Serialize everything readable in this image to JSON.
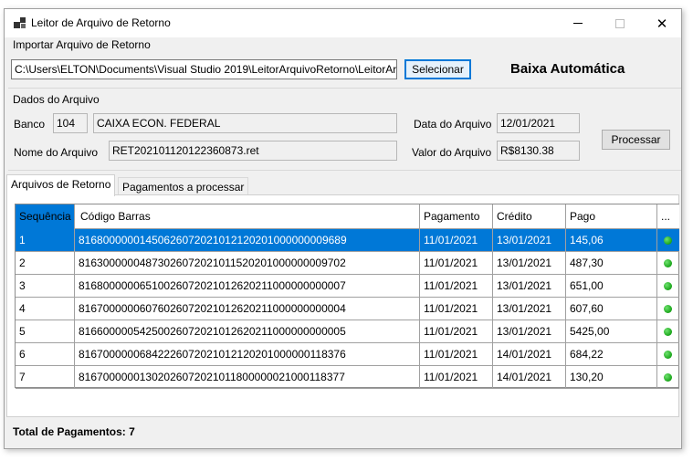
{
  "window": {
    "title": "Leitor de Arquivo de Retorno",
    "close_glyph": "✕"
  },
  "import_group": {
    "label": "Importar Arquivo de Retorno",
    "file_path": "C:\\Users\\ELTON\\Documents\\Visual Studio 2019\\LeitorArquivoRetorno\\LeitorArq",
    "select_button": "Selecionar",
    "heading": "Baixa Automática"
  },
  "file_data": {
    "label": "Dados do Arquivo",
    "bank_label": "Banco",
    "bank_code": "104",
    "bank_name": "CAIXA ECON. FEDERAL",
    "file_name_label": "Nome do Arquivo",
    "file_name": "RET202101120122360873.ret",
    "file_date_label": "Data do Arquivo",
    "file_date": "12/01/2021",
    "file_value_label": "Valor do Arquivo",
    "file_value": "R$8130.38",
    "process_button": "Processar"
  },
  "tabs": [
    {
      "label": "Arquivos de Retorno",
      "active": true
    },
    {
      "label": "Pagamentos a processar",
      "active": false
    }
  ],
  "grid": {
    "columns": [
      "Sequência",
      "Código Barras",
      "Pagamento",
      "Crédito",
      "Pago",
      "..."
    ],
    "rows": [
      {
        "seq": "1",
        "code": "81680000001450626072021012120201000000009689",
        "payment": "11/01/2021",
        "credit": "13/01/2021",
        "paid": "145,06",
        "status": "ok",
        "selected": true
      },
      {
        "seq": "2",
        "code": "81630000004873026072021011520201000000009702",
        "payment": "11/01/2021",
        "credit": "13/01/2021",
        "paid": "487,30",
        "status": "ok",
        "selected": false
      },
      {
        "seq": "3",
        "code": "81680000006510026072021012620211000000000007",
        "payment": "11/01/2021",
        "credit": "13/01/2021",
        "paid": "651,00",
        "status": "ok",
        "selected": false
      },
      {
        "seq": "4",
        "code": "81670000006076026072021012620211000000000004",
        "payment": "11/01/2021",
        "credit": "13/01/2021",
        "paid": "607,60",
        "status": "ok",
        "selected": false
      },
      {
        "seq": "5",
        "code": "81660000054250026072021012620211000000000005",
        "payment": "11/01/2021",
        "credit": "13/01/2021",
        "paid": "5425,00",
        "status": "ok",
        "selected": false
      },
      {
        "seq": "6",
        "code": "81670000006842226072021012120201000000118376",
        "payment": "11/01/2021",
        "credit": "14/01/2021",
        "paid": "684,22",
        "status": "ok",
        "selected": false
      },
      {
        "seq": "7",
        "code": "81670000001302026072021011800000021000118377",
        "payment": "11/01/2021",
        "credit": "14/01/2021",
        "paid": "130,20",
        "status": "ok",
        "selected": false
      }
    ]
  },
  "footer": {
    "total_label": "Total de Pagamentos: 7"
  },
  "colors": {
    "selection": "#0078d7",
    "status_ok": "#1aa51a"
  }
}
